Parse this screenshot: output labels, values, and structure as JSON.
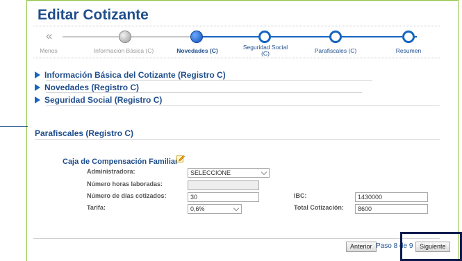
{
  "page": {
    "title": "Editar Cotizante"
  },
  "wizard": {
    "back_arrow": "«",
    "steps": [
      {
        "label": "Menos"
      },
      {
        "label": "Información Básica (C)"
      },
      {
        "label": "Novedades (C)"
      },
      {
        "label_line1": "Seguridad Social",
        "label_line2": "(C)"
      },
      {
        "label": "Parafiscales (C)"
      },
      {
        "label": "Resumen"
      }
    ]
  },
  "sections": [
    {
      "label": "Información Básica del Cotizante (Registro C)"
    },
    {
      "label": "Novedades (Registro C)"
    },
    {
      "label": "Seguridad Social (Registro C)"
    }
  ],
  "parafiscales": {
    "title": "Parafiscales (Registro C)",
    "subtitle": "Caja de Compensación Familiar",
    "fields": {
      "administradora": {
        "label": "Administradora:",
        "value": "SELECCIONE"
      },
      "horas": {
        "label": "Número horas laboradas:",
        "value": ""
      },
      "dias": {
        "label": "Número de días cotizados:",
        "value": "30"
      },
      "tarifa": {
        "label": "Tarifa:",
        "value": "0,6%"
      },
      "ibc": {
        "label": "IBC:",
        "value": "1430000"
      },
      "total": {
        "label": "Total Cotización:",
        "value": "8600"
      }
    }
  },
  "footer": {
    "anterior": "Anterior",
    "paso_text": "Paso 8 de 9",
    "siguiente": "Siguiente"
  },
  "colors": {
    "accent": "#1f4e8c",
    "step_blue": "#1565c0",
    "frame_green": "#8cc63f",
    "highlight": "#0d1b4d"
  }
}
